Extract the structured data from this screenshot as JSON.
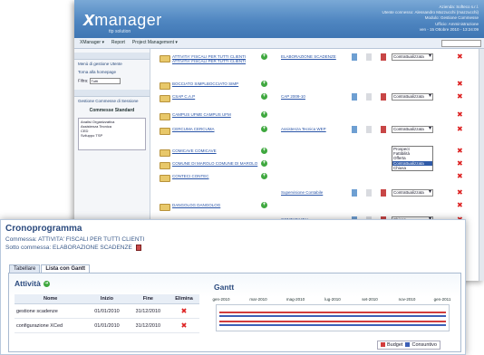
{
  "back_window": {
    "logo_x": "x",
    "logo_name": "manager",
    "logo_sub": "ttp solution",
    "user_info": [
      "Azienda: Softeco s.r.l.",
      "Utente connesso: Alessandro Mazzucchi (mazzucchi)",
      "Modulo: Gestione Commesse",
      "Ufficio: Amministrazione",
      "ven - 15 Ottobre 2010 - 13:24:09"
    ],
    "menu": [
      "XManager ▾",
      "Report",
      "Project Management ▾"
    ],
    "left_panel": {
      "item1": "Menù di gestione Utente",
      "item2": "Torna alla homepage",
      "filter_label": "Filtra:",
      "filter_value": "Tutti",
      "section": "Gestione Commesse di Sessione",
      "title": "Commesse Standard",
      "list": [
        "Analisi Organizzativa",
        "Assistenza Tecnica",
        "CED",
        "Sviluppo TSP"
      ]
    },
    "rows": [
      {
        "label": "ATTIVITA' FISCALI PER TUTTI CLIENTI ATTIVITA' FISCALI PER TUTTI CLIENTI",
        "sub": "ELABORAZIONE SCADENZE",
        "status": "Contrattualizzata"
      },
      {
        "label": "BOCCIATO SIMPLBOCCIATO SIMP",
        "sub": "",
        "status": ""
      },
      {
        "label": "CSAP C.A.P",
        "sub": "CAP 2009-10",
        "status": "Contrattualizzata"
      },
      {
        "label": "CAMPUS UFME CAMPUS UFM",
        "sub": "",
        "status": ""
      },
      {
        "label": "CERCUMA CERCUMA",
        "sub": "Assistenza Tecnica WEP",
        "status": "Contrattualizzata"
      },
      {
        "label": "COMICAVE COMICAVE",
        "sub": "",
        "status": ""
      },
      {
        "label": "COMUNE DI MAROLO COMUNE DI MAROLO",
        "sub": "",
        "status": ""
      },
      {
        "label": "CONTECI CONTEC",
        "sub": "",
        "status": ""
      },
      {
        "label": "",
        "sub": "Supervisione Contabile",
        "status": "Contrattualizzata"
      },
      {
        "label": "DANGOLOG DANGOLOG",
        "sub": "",
        "status": ""
      },
      {
        "label": "",
        "sub": "CONTABILITA'",
        "status": "Chiusa"
      }
    ],
    "dropdown_options": [
      "Prospect",
      "Fattibilità",
      "Offerta",
      "Contrattualizzata",
      "Chiusa"
    ],
    "dropdown_selected": "Contrattualizzata"
  },
  "front_window": {
    "title": "Cronoprogramma",
    "commessa": "Commessa: ATTIVITA' FISCALI PER TUTTI CLIENTI",
    "sotto_commessa": "Sotto commessa: ELABORAZIONE SCADENZE",
    "tabs": [
      "Tabellare",
      "Lista con Gantt"
    ],
    "activity_header": "Attività",
    "columns": [
      "Nome",
      "Inizio",
      "Fine",
      "Elimina"
    ],
    "activities": [
      {
        "name": "gestione scadenze",
        "start": "01/01/2010",
        "end": "31/12/2010",
        "delete": "✖"
      },
      {
        "name": "configurazione XCed",
        "start": "01/01/2010",
        "end": "31/12/2010",
        "delete": "✖"
      }
    ],
    "gantt_header": "Gantt",
    "gantt_axis": [
      "gen-2010",
      "mar-2010",
      "mag-2010",
      "lug-2010",
      "set-2010",
      "nov-2010",
      "gen-2011"
    ],
    "legend": {
      "budget": "Budget",
      "consuntivo": "Consuntivo"
    },
    "colors": {
      "budget": "#d23c3c",
      "consuntivo": "#3d5fb6",
      "accent": "#2b4a7e"
    }
  }
}
